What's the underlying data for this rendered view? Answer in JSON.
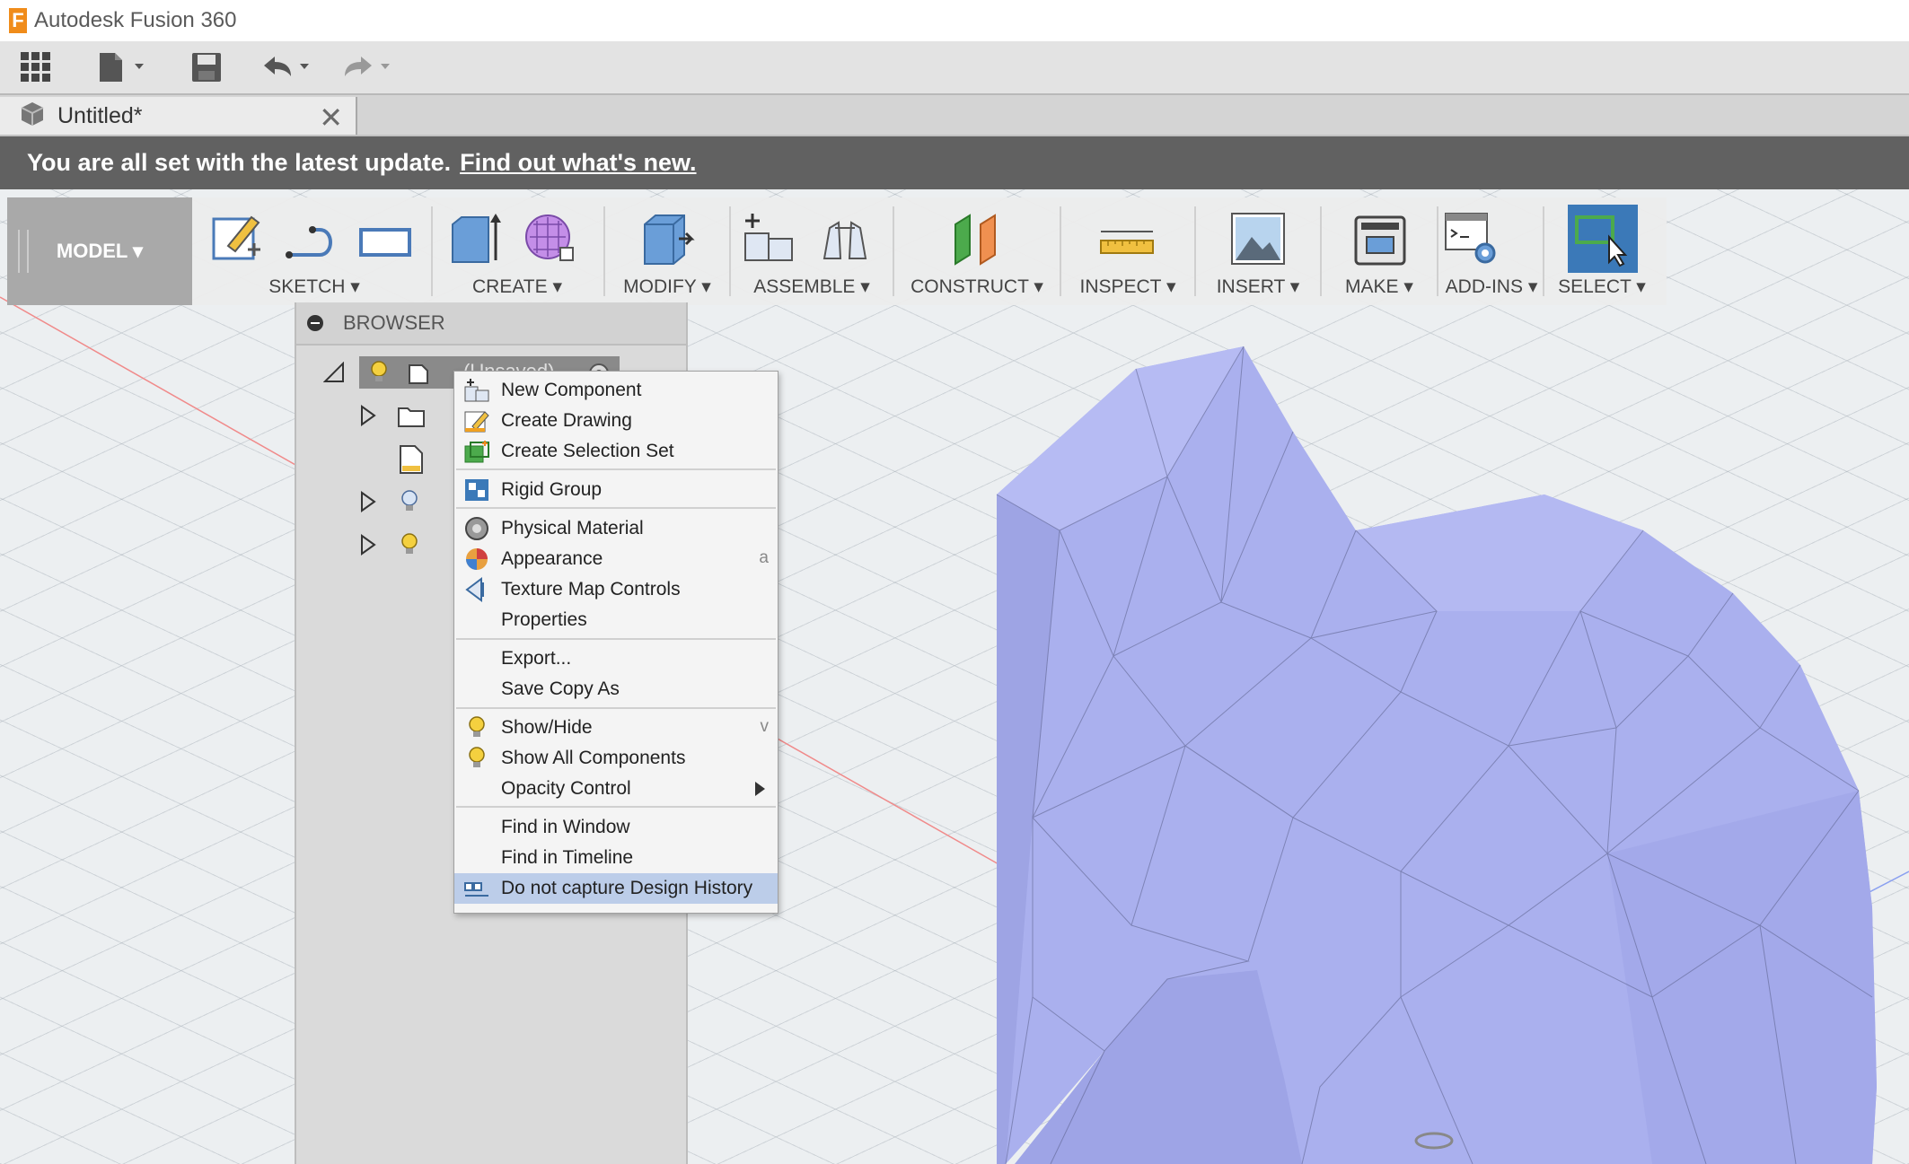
{
  "window": {
    "title": "Autodesk Fusion 360",
    "logo_letter": "F"
  },
  "document_tab": {
    "label": "Untitled*",
    "close": "✕"
  },
  "banner": {
    "message": "You are all set with the latest update.",
    "link": "Find out what's new."
  },
  "ribbon": {
    "workspace": "MODEL ▾",
    "groups": [
      "SKETCH ▾",
      "CREATE ▾",
      "MODIFY ▾",
      "ASSEMBLE ▾",
      "CONSTRUCT ▾",
      "INSPECT ▾",
      "INSERT ▾",
      "MAKE ▾",
      "ADD-INS ▾",
      "SELECT ▾"
    ]
  },
  "browser": {
    "title": "BROWSER",
    "root_label": "(Unsaved)"
  },
  "context_menu": {
    "items": [
      {
        "label": "New Component"
      },
      {
        "label": "Create Drawing"
      },
      {
        "label": "Create Selection Set"
      },
      {
        "label": "Rigid Group"
      },
      {
        "label": "Physical Material"
      },
      {
        "label": "Appearance",
        "shortcut": "a"
      },
      {
        "label": "Texture Map Controls"
      },
      {
        "label": "Properties"
      },
      {
        "label": "Export..."
      },
      {
        "label": "Save Copy As"
      },
      {
        "label": "Show/Hide",
        "shortcut": "v"
      },
      {
        "label": "Show All Components"
      },
      {
        "label": "Opacity Control"
      },
      {
        "label": "Find in Window"
      },
      {
        "label": "Find in Timeline"
      },
      {
        "label": "Do not capture Design History"
      }
    ]
  },
  "colors": {
    "mesh": "#aab0ee",
    "banner": "#616161",
    "highlight": "#bccde9",
    "select_active": "#3b79b8"
  }
}
